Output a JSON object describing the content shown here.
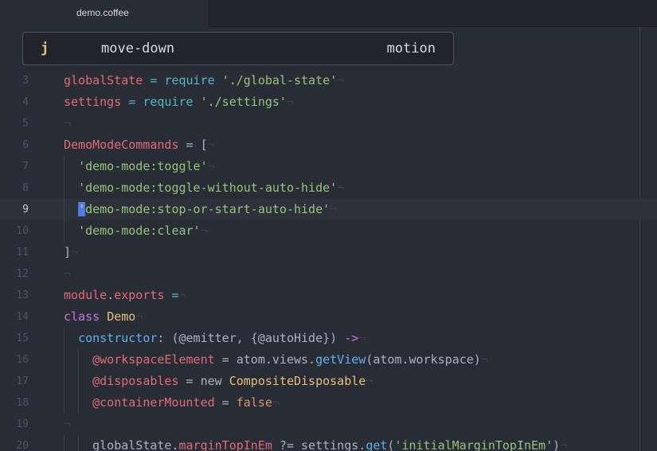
{
  "tab": {
    "title": "demo.coffee"
  },
  "popup": {
    "key": "j",
    "command": "move-down",
    "category": "motion"
  },
  "lines": [
    {
      "num": "3",
      "tokens": [
        [
          "v",
          "globalState"
        ],
        [
          "p",
          " "
        ],
        [
          "o",
          "="
        ],
        [
          "p",
          " "
        ],
        [
          "o",
          "require"
        ],
        [
          "p",
          " "
        ],
        [
          "s",
          "'./global-state'"
        ]
      ]
    },
    {
      "num": "4",
      "tokens": [
        [
          "v",
          "settings"
        ],
        [
          "p",
          " "
        ],
        [
          "o",
          "="
        ],
        [
          "p",
          " "
        ],
        [
          "o",
          "require"
        ],
        [
          "p",
          " "
        ],
        [
          "s",
          "'./settings'"
        ]
      ]
    },
    {
      "num": "5",
      "tokens": []
    },
    {
      "num": "6",
      "tokens": [
        [
          "v",
          "DemoModeCommands"
        ],
        [
          "p",
          " = ["
        ]
      ]
    },
    {
      "num": "7",
      "tokens": [
        [
          "p",
          "  "
        ],
        [
          "s",
          "'demo-mode:toggle'"
        ]
      ]
    },
    {
      "num": "8",
      "tokens": [
        [
          "p",
          "  "
        ],
        [
          "s",
          "'demo-mode:toggle-without-auto-hide'"
        ]
      ]
    },
    {
      "num": "9",
      "tokens": [
        [
          "p",
          "  "
        ],
        [
          "cursor",
          "'"
        ],
        [
          "s",
          "demo-mode:stop-or-start-auto-hide'"
        ]
      ]
    },
    {
      "num": "10",
      "tokens": [
        [
          "p",
          "  "
        ],
        [
          "s",
          "'demo-mode:clear'"
        ]
      ]
    },
    {
      "num": "11",
      "tokens": [
        [
          "p",
          "]"
        ]
      ]
    },
    {
      "num": "12",
      "tokens": []
    },
    {
      "num": "13",
      "tokens": [
        [
          "v",
          "module"
        ],
        [
          "p",
          "."
        ],
        [
          "v",
          "exports"
        ],
        [
          "p",
          " "
        ],
        [
          "o",
          "="
        ]
      ]
    },
    {
      "num": "14",
      "tokens": [
        [
          "k",
          "class"
        ],
        [
          "p",
          " "
        ],
        [
          "c",
          "Demo"
        ]
      ]
    },
    {
      "num": "15",
      "tokens": [
        [
          "p",
          "  "
        ],
        [
          "f",
          "constructor"
        ],
        [
          "p",
          ": (@emitter, {@autoHide}) "
        ],
        [
          "k",
          "->"
        ]
      ]
    },
    {
      "num": "16",
      "tokens": [
        [
          "p",
          "    "
        ],
        [
          "v",
          "@workspaceElement"
        ],
        [
          "p",
          " = atom.views."
        ],
        [
          "f",
          "getView"
        ],
        [
          "p",
          "(atom.workspace)"
        ]
      ]
    },
    {
      "num": "17",
      "tokens": [
        [
          "p",
          "    "
        ],
        [
          "v",
          "@disposables"
        ],
        [
          "p",
          " = new "
        ],
        [
          "c",
          "CompositeDisposable"
        ]
      ]
    },
    {
      "num": "18",
      "tokens": [
        [
          "p",
          "    "
        ],
        [
          "v",
          "@containerMounted"
        ],
        [
          "p",
          " = "
        ],
        [
          "n",
          "false"
        ]
      ]
    },
    {
      "num": "19",
      "tokens": []
    },
    {
      "num": "20",
      "tokens": [
        [
          "p",
          "    globalState."
        ],
        [
          "v",
          "marginTopInEm"
        ],
        [
          "p",
          " ?= settings."
        ],
        [
          "f",
          "get"
        ],
        [
          "p",
          "("
        ],
        [
          "s",
          "'initialMarginTopInEm'"
        ],
        [
          "p",
          ")"
        ]
      ]
    }
  ],
  "cursor_line": "9"
}
